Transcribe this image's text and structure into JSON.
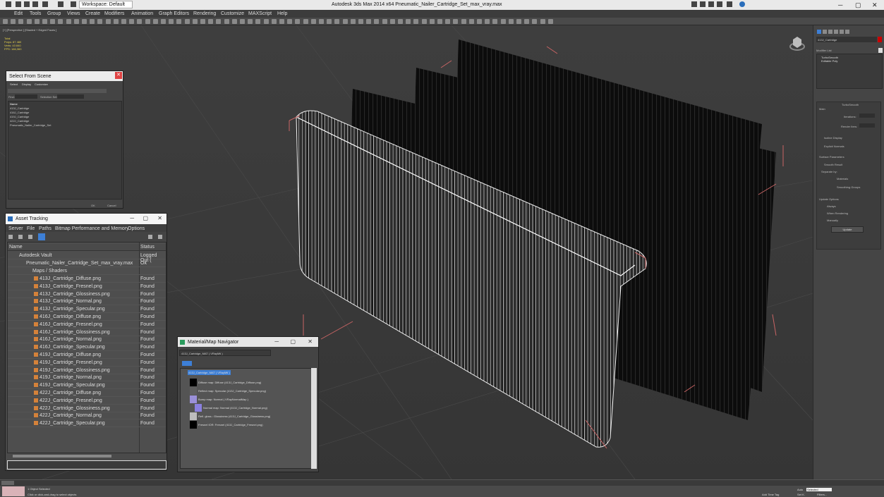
{
  "titlebar": {
    "workspace": "Workspace: Default",
    "app_title": "Autodesk 3ds Max  2014 x64     Pneumatic_Nailer_Cartridge_Set_max_vray.max"
  },
  "menubar": [
    "Edit",
    "Tools",
    "Group",
    "Views",
    "Create",
    "Modifiers",
    "Animation",
    "Graph Editors",
    "Rendering",
    "Customize",
    "MAXScript",
    "Help"
  ],
  "viewport": {
    "label": "[+] [Perspective ] [Shaded + Edged Faces ]",
    "stats": [
      "Total",
      "Polys: 87 480",
      "Verts: 43 840",
      "",
      "FPS: 166,360"
    ]
  },
  "select_from_scene": {
    "title": "Select From Scene",
    "menu": [
      "Select",
      "Display",
      "Customize"
    ],
    "find_label": "Find:",
    "selection_set": "Selection Set:",
    "column": "Name",
    "items": [
      "413J_Cartridge",
      "416J_Cartridge",
      "419J_Cartridge",
      "422J_Cartridge",
      "Pneumatic_Nailer_Cartridge_Set"
    ],
    "ok": "OK",
    "cancel": "Cancel"
  },
  "asset_tracking": {
    "title": "Asset Tracking",
    "menu": [
      "Server",
      "File",
      "Paths",
      "Bitmap Performance and Memory",
      "Options"
    ],
    "col_name": "Name",
    "col_status": "Status",
    "vault": {
      "name": "Autodesk Vault",
      "status": "Logged Out ("
    },
    "maxfile": {
      "name": "Pneumatic_Nailer_Cartridge_Set_max_vray.max",
      "status": "Ok"
    },
    "folder": "Maps / Shaders",
    "files": [
      {
        "name": "413J_Cartridge_Diffuse.png",
        "status": "Found"
      },
      {
        "name": "413J_Cartridge_Fresnel.png",
        "status": "Found"
      },
      {
        "name": "413J_Cartridge_Glossiness.png",
        "status": "Found"
      },
      {
        "name": "413J_Cartridge_Normal.png",
        "status": "Found"
      },
      {
        "name": "413J_Cartridge_Specular.png",
        "status": "Found"
      },
      {
        "name": "416J_Cartridge_Diffuse.png",
        "status": "Found"
      },
      {
        "name": "416J_Cartridge_Fresnel.png",
        "status": "Found"
      },
      {
        "name": "416J_Cartridge_Glossiness.png",
        "status": "Found"
      },
      {
        "name": "416J_Cartridge_Normal.png",
        "status": "Found"
      },
      {
        "name": "416J_Cartridge_Specular.png",
        "status": "Found"
      },
      {
        "name": "419J_Cartridge_Diffuse.png",
        "status": "Found"
      },
      {
        "name": "419J_Cartridge_Fresnel.png",
        "status": "Found"
      },
      {
        "name": "419J_Cartridge_Glossiness.png",
        "status": "Found"
      },
      {
        "name": "419J_Cartridge_Normal.png",
        "status": "Found"
      },
      {
        "name": "419J_Cartridge_Specular.png",
        "status": "Found"
      },
      {
        "name": "422J_Cartridge_Diffuse.png",
        "status": "Found"
      },
      {
        "name": "422J_Cartridge_Fresnel.png",
        "status": "Found"
      },
      {
        "name": "422J_Cartridge_Glossiness.png",
        "status": "Found"
      },
      {
        "name": "422J_Cartridge_Normal.png",
        "status": "Found"
      },
      {
        "name": "422J_Cartridge_Specular.png",
        "status": "Found"
      }
    ]
  },
  "material_navigator": {
    "title": "Material/Map Navigator",
    "field": "413J_Cartridge_MAT ( VRayMtl )",
    "root": "413J_Cartridge_MAT ( VRayMtl )",
    "entries": [
      "Diffuse map: Diffuse (413J_Cartridge_Diffuse.png)",
      "Reflect map: Specular (413J_Cartridge_Specular.png)",
      "Bump map: Normal ( VRayNormalMap )",
      "Normal map: Normal (413J_Cartridge_Normal.png)",
      "Refl. gloss.: Glossiness (413J_Cartridge_Glossiness.png)",
      "Fresnel IOR: Fresnel (413J_Cartridge_Fresnel.png)"
    ]
  },
  "command_panel": {
    "object_name": "413J_Cartridge",
    "modifier_list": "Modifier List",
    "stack": [
      "TurboSmooth",
      "Editable Poly"
    ],
    "rollout_title": "TurboSmooth",
    "main": "Main",
    "iterations": "Iterations:",
    "render_iters": "Render Iters:",
    "isoline": "Isoline Display",
    "explicit": "Explicit Normals",
    "surface": "Surface Parameters",
    "smooth_result": "Smooth Result",
    "separate": "Separate by:",
    "materials": "Materials",
    "smoothing": "Smoothing Groups",
    "update_options": "Update Options",
    "always": "Always",
    "when_rendering": "When Rendering",
    "manually": "Manually",
    "update": "Update"
  },
  "status": {
    "selected": "1 Object Selected",
    "prompt": "Click or click-and-drag to select objects",
    "add_time_tag": "Add Time Tag",
    "auto": "Auto",
    "selected_dd": "Selected",
    "set_key": "Set K.",
    "filters": "Filters..."
  },
  "colors": {
    "viewport_bg": "#3b3b3b",
    "wire_white": "#f2f2f2",
    "bbox_red": "#c86464",
    "highlight": "#4a86e8"
  }
}
